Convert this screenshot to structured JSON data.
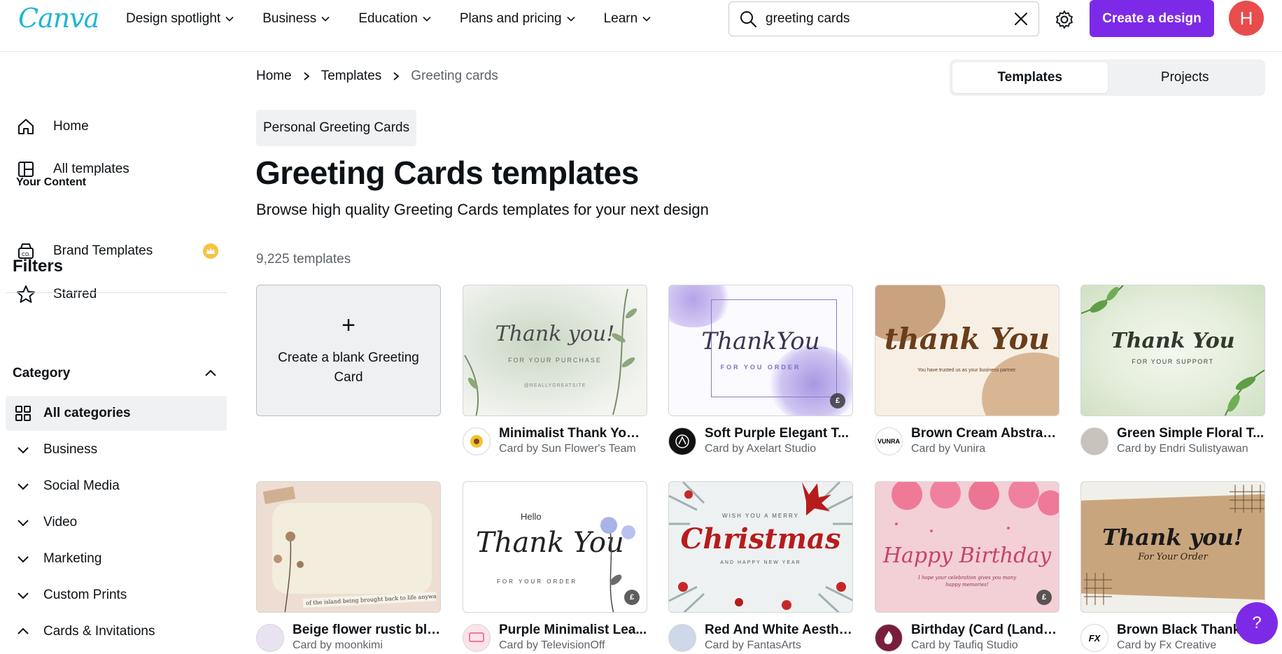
{
  "brand": {
    "logo": "Canva"
  },
  "nav": {
    "items": [
      {
        "label": "Design spotlight"
      },
      {
        "label": "Business"
      },
      {
        "label": "Education"
      },
      {
        "label": "Plans and pricing"
      },
      {
        "label": "Learn"
      }
    ],
    "search_value": "greeting cards",
    "create_label": "Create a design",
    "avatar_initial": "H"
  },
  "sidebar": {
    "home": "Home",
    "all_templates": "All templates",
    "your_content": "Your Content",
    "brand_templates": "Brand Templates",
    "starred": "Starred",
    "filters": "Filters",
    "category": "Category",
    "categories": [
      {
        "label": "All categories"
      },
      {
        "label": "Business"
      },
      {
        "label": "Social Media"
      },
      {
        "label": "Video"
      },
      {
        "label": "Marketing"
      },
      {
        "label": "Custom Prints"
      },
      {
        "label": "Cards & Invitations"
      }
    ]
  },
  "main": {
    "breadcrumb": [
      "Home",
      "Templates",
      "Greeting cards"
    ],
    "tabs": [
      "Templates",
      "Projects"
    ],
    "chip": "Personal Greeting Cards",
    "title": "Greeting Cards templates",
    "subtitle": "Browse high quality Greeting Cards templates for your next design",
    "count": "9,225 templates",
    "blank_card": "Create a blank Greeting Card",
    "cards": [
      {
        "name": "Minimalist Thank You ...",
        "author": "Card by Sun Flower's Team",
        "thumb_line1": "Thank you!",
        "thumb_line2": "FOR YOUR PURCHASE",
        "thumb_line3": "@REALLYGREATSITE"
      },
      {
        "name": "Soft Purple Elegant T...",
        "author": "Card by Axelart Studio",
        "thumb_line1": "ThankYou",
        "thumb_line2": "FOR YOU ORDER",
        "badge": "£"
      },
      {
        "name": "Brown Cream Abstrac...",
        "author": "Card by Vunira",
        "avatar_text": "VUNRA",
        "thumb_line1": "thank You",
        "thumb_line2": "You have trusted us as your business partner."
      },
      {
        "name": "Green Simple Floral T...",
        "author": "Card by Endri Sulistyawan",
        "thumb_line1": "Thank You",
        "thumb_line2": "FOR YOUR SUPPORT"
      },
      {
        "name": "Beige flower rustic bla...",
        "author": "Card by moonkimi",
        "thumb_line1": "of the island being brought back to life anyway..."
      },
      {
        "name": "Purple Minimalist Lea...",
        "author": "Card by TelevisionOff",
        "thumb_line0": "Hello",
        "thumb_line1": "Thank You",
        "thumb_line2": "FOR YOUR ORDER",
        "badge": "£"
      },
      {
        "name": "Red And White Aesthe...",
        "author": "Card by FantasArts",
        "thumb_line0": "WISH YOU A MERRY",
        "thumb_line1": "Christmas",
        "thumb_line2": "AND HAPPY NEW YEAR"
      },
      {
        "name": "Birthday (Card (Lands...",
        "author": "Card by Taufiq Studio",
        "thumb_line1": "Happy Birthday",
        "thumb_line2": "I hope your celebration gives you many happy memories!",
        "badge": "£"
      },
      {
        "name": "Brown Black Thank ...",
        "author": "Card by Fx Creative",
        "avatar_text": "FX",
        "thumb_line1": "Thank you!",
        "thumb_line2": "For Your Order"
      }
    ]
  },
  "help_label": "?",
  "colors": {
    "brand_purple": "#7d2ae8",
    "avatar_red": "#e84c4c",
    "logo_teal": "#20b5d7"
  }
}
